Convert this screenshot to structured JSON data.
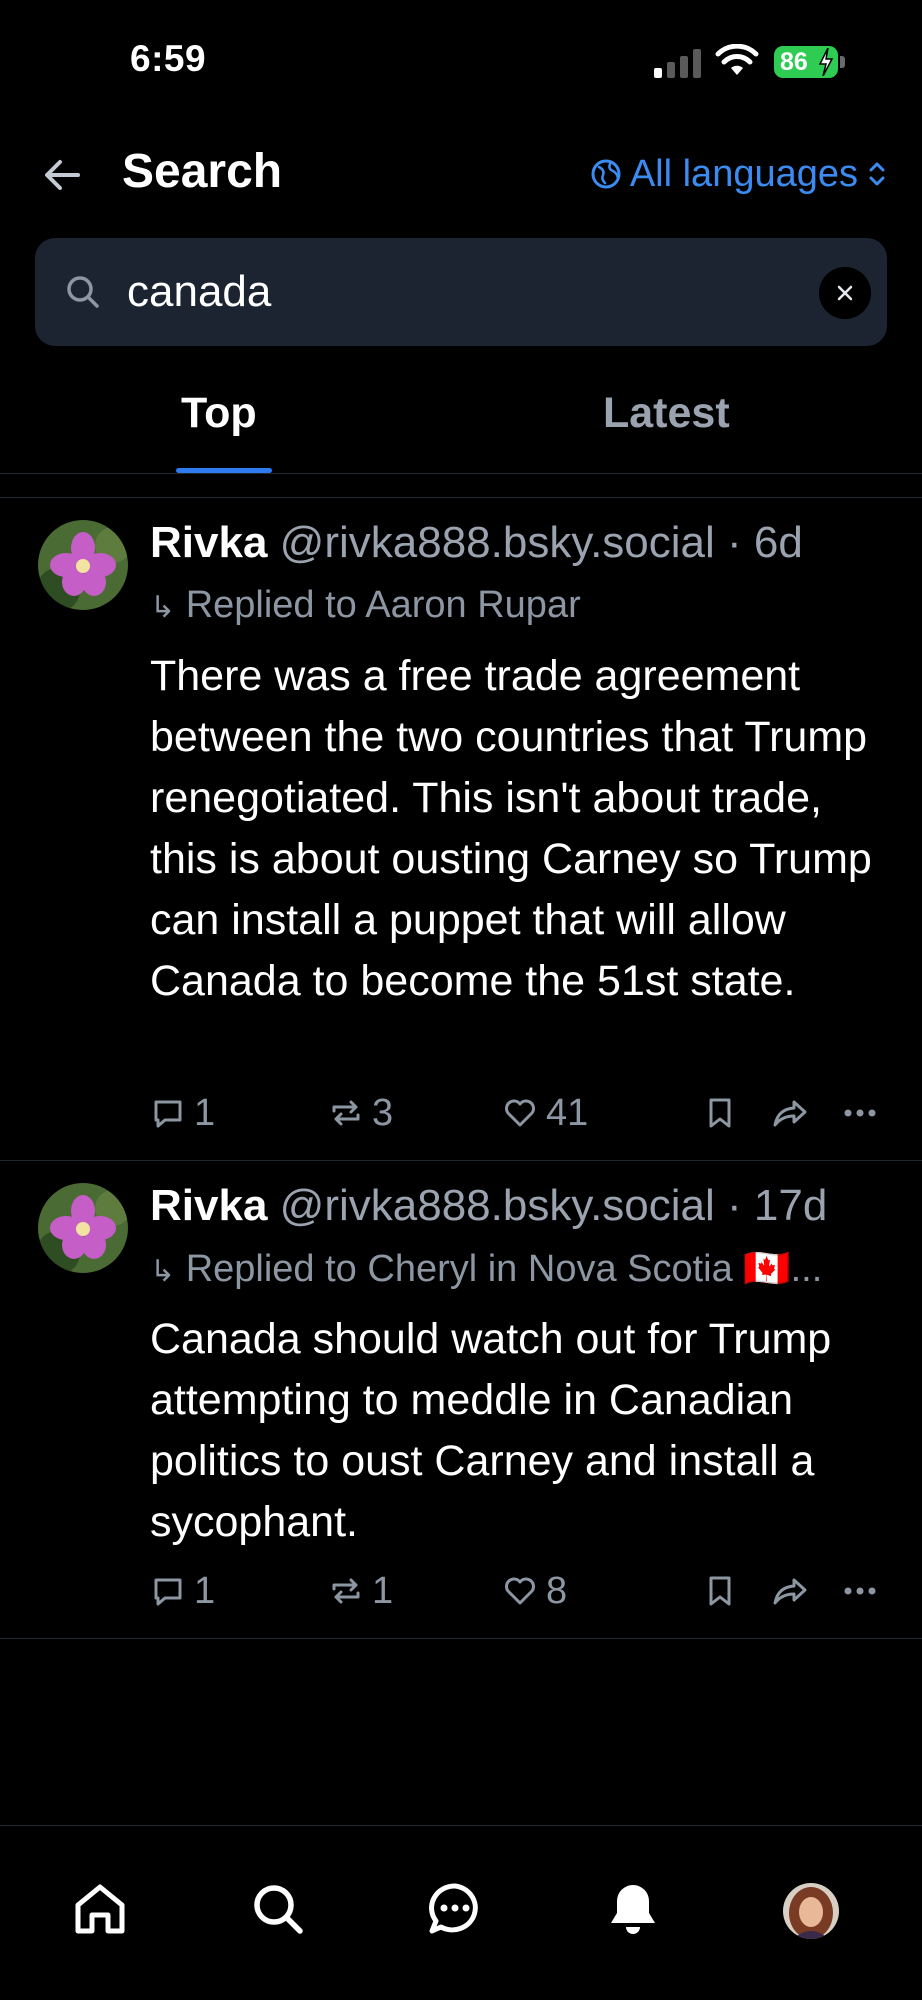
{
  "status_bar": {
    "time": "6:59",
    "battery": "86"
  },
  "header": {
    "back_icon": "arrow-left-icon",
    "title": "Search",
    "language_label": "All languages",
    "language_icon": "globe-icon"
  },
  "search": {
    "value": "canada",
    "icon": "search-icon",
    "clear_icon": "close-icon"
  },
  "tabs": [
    {
      "label": "Top",
      "active": true
    },
    {
      "label": "Latest",
      "active": false
    }
  ],
  "posts": [
    {
      "author": "Rivka",
      "handle": "@rivka888.bsky.social",
      "time": "· 6d",
      "reply_to": "Replied to Aaron Rupar",
      "text": "There was a free trade agreement between the two countries that Trump renegotiated. This isn't about trade, this is about ousting Carney so Trump can install a puppet that will allow Canada to become the 51st state.",
      "replies": "1",
      "reposts": "3",
      "likes": "41"
    },
    {
      "author": "Rivka",
      "handle": "@rivka888.bsky.social",
      "time": "· 17d",
      "reply_to": "Replied to Cheryl in Nova Scotia 🇨🇦...",
      "text": "Canada should watch out for Trump attempting to meddle in Canadian politics to oust Carney and install a sycophant.",
      "replies": "1",
      "reposts": "1",
      "likes": "8"
    }
  ],
  "tab_bar": {
    "items": [
      "home-icon",
      "search-icon",
      "chat-icon",
      "bell-icon",
      "profile-avatar"
    ]
  },
  "colors": {
    "accent": "#2f7bf0",
    "link": "#3b8cf2",
    "muted": "#8d96a3",
    "search_bg": "#1c2431",
    "battery": "#2ecc52"
  }
}
